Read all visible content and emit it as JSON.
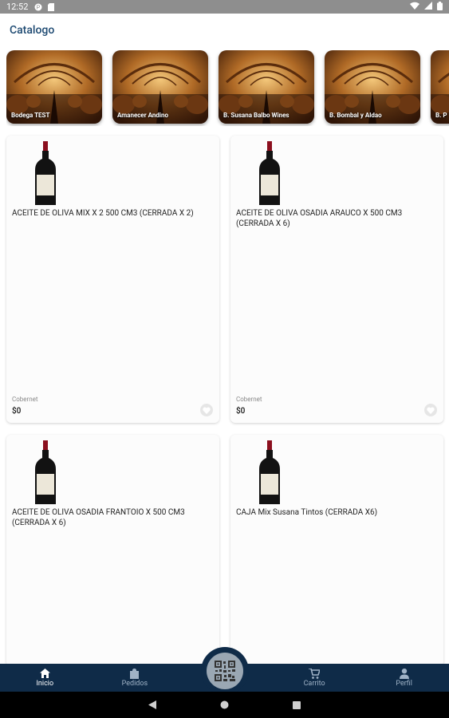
{
  "status_bar": {
    "time": "12:52"
  },
  "header": {
    "title": "Catalogo"
  },
  "categories": [
    {
      "label": "Bodega TEST"
    },
    {
      "label": "Amanecer Andino"
    },
    {
      "label": "B. Susana Balbo Wines"
    },
    {
      "label": "B. Bombal y Aldao"
    },
    {
      "label": "B. P"
    }
  ],
  "products": [
    {
      "name": "ACEITE DE OLIVA MIX X 2 500 CM3 (CERRADA X 2)",
      "varietal": "Cobernet",
      "price": "$0"
    },
    {
      "name": "ACEITE DE OLIVA OSADIA ARAUCO X 500 CM3 (CERRADA X 6)",
      "varietal": "Cobernet",
      "price": "$0"
    },
    {
      "name": "ACEITE DE OLIVA OSADIA FRANTOIO X 500 CM3 (CERRADA X 6)",
      "varietal": "",
      "price": ""
    },
    {
      "name": "CAJA Mix Susana Tintos (CERRADA X6)",
      "varietal": "",
      "price": ""
    }
  ],
  "bottom_nav": {
    "items": [
      {
        "label": "Inicio",
        "icon": "home-icon",
        "active": true
      },
      {
        "label": "Pedidos",
        "icon": "bag-icon",
        "active": false
      },
      {
        "label": "Carrito",
        "icon": "cart-icon",
        "active": false
      },
      {
        "label": "Perfil",
        "icon": "person-icon",
        "active": false
      }
    ],
    "fab_icon": "qr-code-icon"
  },
  "colors": {
    "nav_bg": "#0f2b48",
    "title": "#1e4a72",
    "status_bar": "#8e8e8e"
  }
}
